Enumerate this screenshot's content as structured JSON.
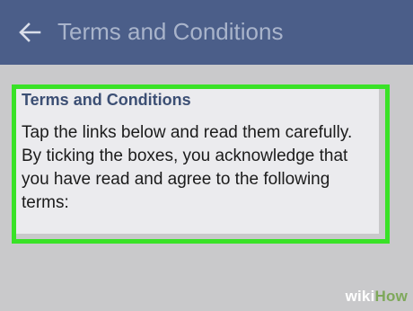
{
  "app_bar": {
    "title": "Terms and Conditions",
    "back_icon": "arrow-left-icon"
  },
  "card": {
    "heading": "Terms and Conditions",
    "body_lines": [
      "Tap the links below and read them carefully.",
      "By ticking the boxes, you acknowledge that",
      "you have read and agree to the following",
      "terms:"
    ]
  },
  "watermark": {
    "part1": "wiki",
    "part2": "How"
  },
  "colors": {
    "app_bar": "#4b5e89",
    "app_title": "#a9b4cb",
    "background": "#c9c9cb",
    "card": "#ebebee",
    "highlight": "#39e227",
    "heading": "#3c4f74"
  }
}
